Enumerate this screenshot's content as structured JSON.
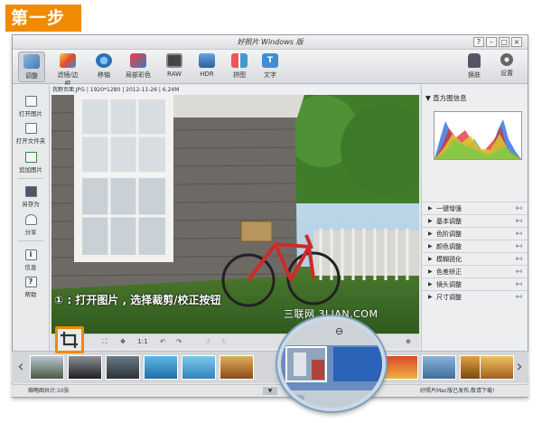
{
  "step_label": "第一步",
  "window": {
    "title": "好照片 Windows 版",
    "controls": [
      "?",
      "–",
      "□",
      "×"
    ]
  },
  "toolbar": {
    "items": [
      {
        "label": "调整",
        "icon": "adjust-icon",
        "active": true
      },
      {
        "label": "滤镜/边框",
        "icon": "filter-icon"
      },
      {
        "label": "移轴",
        "icon": "tilt-shift-icon"
      },
      {
        "label": "局部彩色",
        "icon": "local-color-icon"
      },
      {
        "label": "RAW",
        "icon": "raw-icon"
      },
      {
        "label": "HDR",
        "icon": "hdr-icon"
      },
      {
        "label": "拼图",
        "icon": "collage-icon"
      },
      {
        "label": "文字",
        "icon": "text-icon"
      }
    ],
    "right_items": [
      {
        "label": "换肤",
        "icon": "skin-icon"
      },
      {
        "label": "设置",
        "icon": "gear-icon"
      }
    ]
  },
  "file_info": "我野页面.JPG | 1920*1280 | 2012-11-26 | 6.24M",
  "sidebar": {
    "items": [
      {
        "label": "打开图片",
        "icon": "open-image-icon"
      },
      {
        "label": "打开文件夹",
        "icon": "open-folder-icon"
      },
      {
        "label": "追加图片",
        "icon": "append-image-icon"
      },
      {
        "label": "另存为",
        "icon": "save-as-icon"
      },
      {
        "label": "分享",
        "icon": "share-icon"
      },
      {
        "label": "信息",
        "icon": "info-icon"
      },
      {
        "label": "帮助",
        "icon": "help-icon"
      }
    ]
  },
  "image_controls": {
    "one_to_one": "1:1"
  },
  "right_panel": {
    "histogram_title": "直方图信息",
    "sections": [
      "一键增强",
      "基本调整",
      "色阶调整",
      "颜色调整",
      "模糊锐化",
      "色差矫正",
      "镜头调整",
      "尺寸调整"
    ]
  },
  "callout_text": "① : 打开图片 , 选择裁剪/校正按钮",
  "watermark": "三联网 3LIAN.COM",
  "status": {
    "left": "缩略图共计:10张",
    "right": "好照片Mac版已发布,敬请下载!"
  },
  "colors": {
    "accent": "#f08a00",
    "highlight_border": "#f08a00"
  }
}
